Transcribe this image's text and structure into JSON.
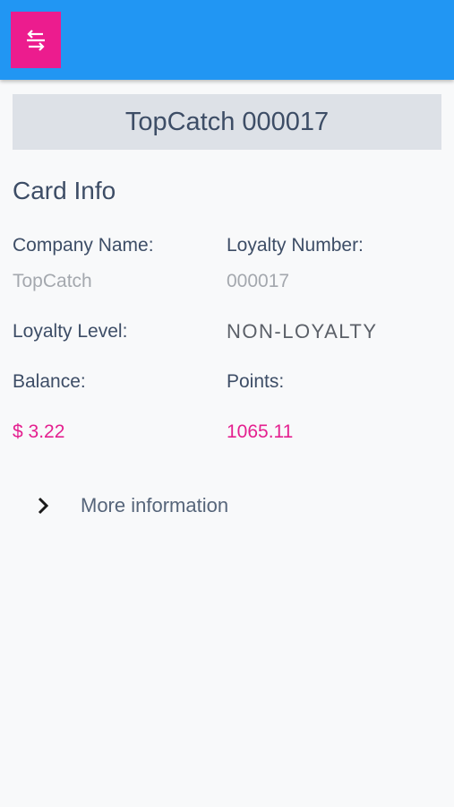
{
  "header": {
    "menu_icon": "menu-toggle-icon",
    "accent": "#2196f3",
    "button_color": "#ec1c8e"
  },
  "card": {
    "title": "TopCatch 000017"
  },
  "info": {
    "section_title": "Card Info",
    "company_label": "Company Name:",
    "company_value": "TopCatch",
    "loyalty_number_label": "Loyalty Number:",
    "loyalty_number_value": "000017",
    "loyalty_level_label": "Loyalty Level:",
    "loyalty_level_value": "NON-LOYALTY",
    "balance_label": "Balance:",
    "balance_value": "$ 3.22",
    "points_label": "Points:",
    "points_value": "1065.11"
  },
  "more": {
    "label": "More information",
    "icon": "chevron-right-icon"
  }
}
